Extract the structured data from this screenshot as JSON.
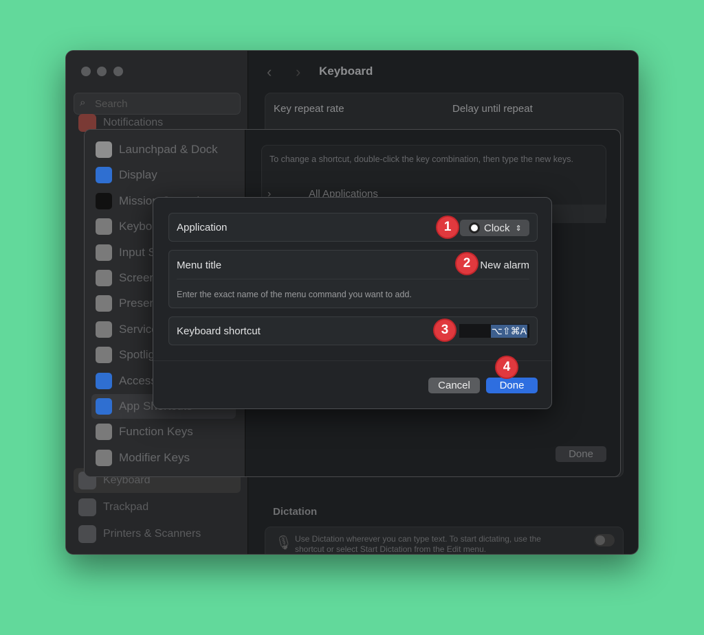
{
  "window": {
    "title": "Keyboard",
    "search_placeholder": "Search"
  },
  "sidebar": {
    "items": [
      {
        "label": "Notifications"
      },
      {
        "label": "Keyboard"
      },
      {
        "label": "Trackpad"
      },
      {
        "label": "Printers & Scanners"
      }
    ]
  },
  "main": {
    "key_repeat_label": "Key repeat rate",
    "delay_label": "Delay until repeat",
    "dictation_heading": "Dictation",
    "dictation_text": "Use Dictation wherever you can type text. To start dictating, use the shortcut or select Start Dictation from the Edit menu.",
    "dictation_enabled": false
  },
  "sheet": {
    "sidebar": [
      {
        "label": "Launchpad & Dock",
        "color": "#8e8e8e"
      },
      {
        "label": "Display",
        "color": "#2f6fd1"
      },
      {
        "label": "Mission Control",
        "color": "#111111"
      },
      {
        "label": "Keyboard",
        "color": "#7a7a7a"
      },
      {
        "label": "Input Sources",
        "color": "#7a7a7a"
      },
      {
        "label": "Screenshots",
        "color": "#7a7a7a"
      },
      {
        "label": "Presenter Overlay",
        "color": "#7a7a7a"
      },
      {
        "label": "Services",
        "color": "#7a7a7a"
      },
      {
        "label": "Spotlight",
        "color": "#7a7a7a"
      },
      {
        "label": "Accessibility",
        "color": "#2f6fd1"
      },
      {
        "label": "App Shortcuts",
        "color": "#2f6fd1",
        "selected": true
      },
      {
        "label": "Function Keys",
        "color": "#7a7a7a"
      },
      {
        "label": "Modifier Keys",
        "color": "#7a7a7a"
      }
    ],
    "hint": "To change a shortcut, double-click the key combination, then type the new keys.",
    "group": "All Applications",
    "done_label": "Done"
  },
  "dialog": {
    "application_label": "Application",
    "application_value": "Clock",
    "menu_title_label": "Menu title",
    "menu_title_value": "New alarm",
    "menu_title_hint": "Enter the exact name of the menu command you want to add.",
    "shortcut_label": "Keyboard shortcut",
    "shortcut_value": "⌥⇧⌘A",
    "cancel_label": "Cancel",
    "done_label": "Done",
    "accent": "#2e6ee0"
  },
  "annotations": [
    "1",
    "2",
    "3",
    "4"
  ]
}
